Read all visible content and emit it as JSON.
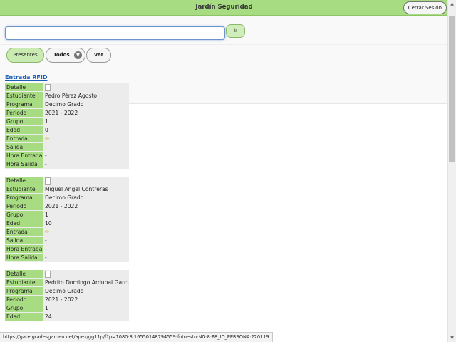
{
  "header": {
    "title": "Jardín Seguridad",
    "logout_label": "Cerrar Sesión"
  },
  "search": {
    "value": "",
    "go_label": "Ir"
  },
  "filters": {
    "present_label": "Presentes",
    "todos_label": "Todos",
    "ver_label": "Ver"
  },
  "section_title": "Entrada RFID",
  "labels": {
    "detalle": "Detalle",
    "estudiante": "Estudiante",
    "programa": "Programa",
    "periodo": "Periodo",
    "grupo": "Grupo",
    "edad": "Edad",
    "entrada": "Entrada",
    "salida": "Salida",
    "hora_entrada": "Hora Entrada",
    "hora_salida": "Hora Salida"
  },
  "records": [
    {
      "estudiante": "Pedro Pérez Agosto",
      "programa": "Decimo Grado",
      "periodo": "2021 - 2022",
      "grupo": "1",
      "edad": "0",
      "salida": "-",
      "hora_entrada": "-",
      "hora_salida": "-"
    },
    {
      "estudiante": "Miguel Angel Contreras",
      "programa": "Decimo Grado",
      "periodo": "2021 - 2022",
      "grupo": "1",
      "edad": "10",
      "salida": "-",
      "hora_entrada": "-",
      "hora_salida": "-"
    },
    {
      "estudiante": "Pedrito Domingo Ardubal Garcia",
      "programa": "Decimo Grado",
      "periodo": "2021 - 2022",
      "grupo": "1",
      "edad": "24"
    }
  ],
  "statusbar": {
    "url": "https://gate.gradesgarden.net/apex/gg11p/f?p=1080:8:16550148794559:fotoestu:NO:8:P8_ID_PERSONA:220119"
  },
  "icons": {
    "detail": "document-icon",
    "entry": "pencil-icon",
    "todos_toggle": "chevron-down-icon"
  },
  "colors": {
    "header": "#a8dc82",
    "label_cell": "#a8dc82",
    "link": "#1a5fb4"
  }
}
